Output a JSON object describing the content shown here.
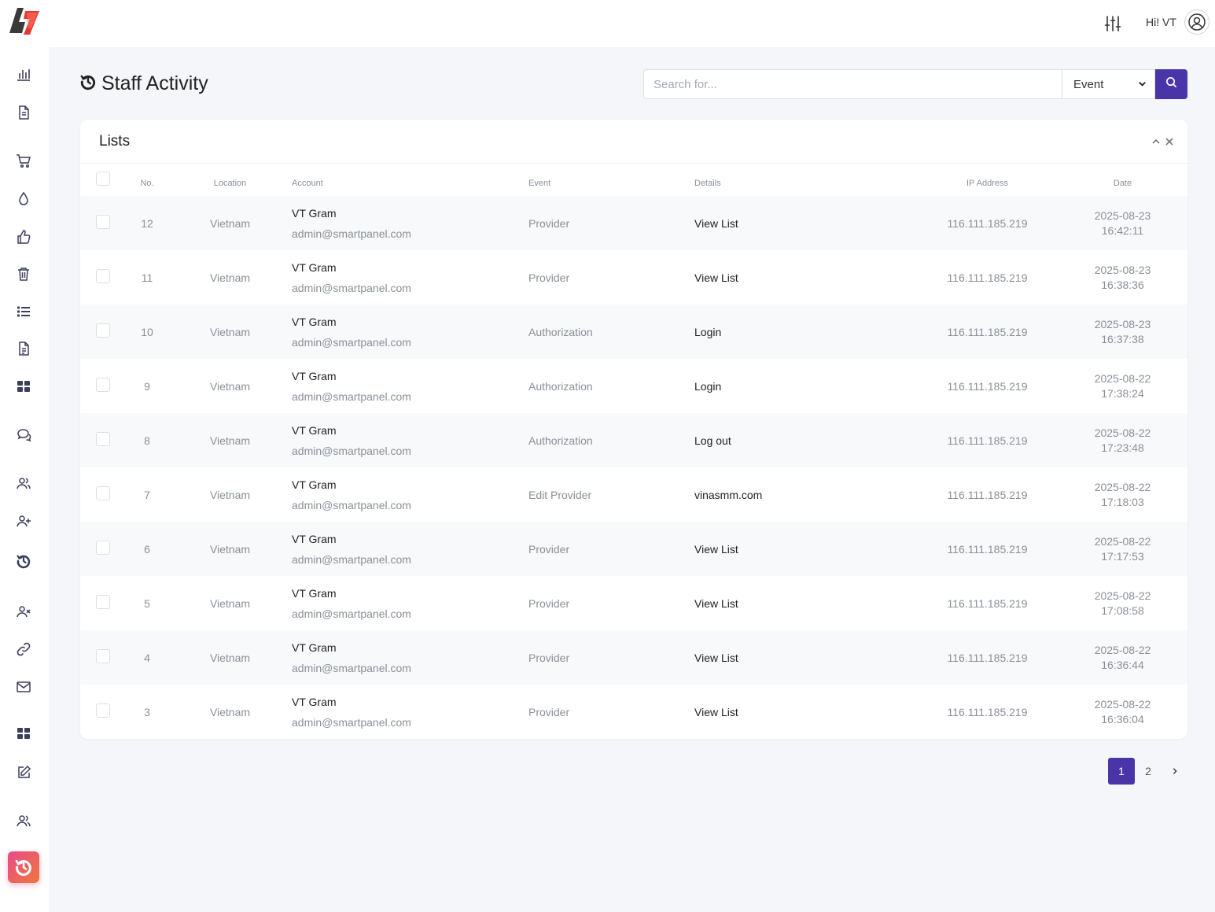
{
  "header": {
    "greeting": "Hi! VT"
  },
  "page": {
    "title": "Staff Activity"
  },
  "search": {
    "placeholder": "Search for...",
    "filter_selected": "Event"
  },
  "card": {
    "title": "Lists"
  },
  "table": {
    "columns": [
      "No.",
      "Location",
      "Account",
      "Event",
      "Details",
      "IP Address",
      "Date"
    ],
    "rows": [
      {
        "no": "12",
        "location": "Vietnam",
        "name": "VT Gram",
        "email": "admin@smartpanel.com",
        "event": "Provider",
        "details": "View List",
        "ip": "116.111.185.219",
        "date": "2025-08-23",
        "time": "16:42:11"
      },
      {
        "no": "11",
        "location": "Vietnam",
        "name": "VT Gram",
        "email": "admin@smartpanel.com",
        "event": "Provider",
        "details": "View List",
        "ip": "116.111.185.219",
        "date": "2025-08-23",
        "time": "16:38:36"
      },
      {
        "no": "10",
        "location": "Vietnam",
        "name": "VT Gram",
        "email": "admin@smartpanel.com",
        "event": "Authorization",
        "details": "Login",
        "ip": "116.111.185.219",
        "date": "2025-08-23",
        "time": "16:37:38"
      },
      {
        "no": "9",
        "location": "Vietnam",
        "name": "VT Gram",
        "email": "admin@smartpanel.com",
        "event": "Authorization",
        "details": "Login",
        "ip": "116.111.185.219",
        "date": "2025-08-22",
        "time": "17:38:24"
      },
      {
        "no": "8",
        "location": "Vietnam",
        "name": "VT Gram",
        "email": "admin@smartpanel.com",
        "event": "Authorization",
        "details": "Log out",
        "ip": "116.111.185.219",
        "date": "2025-08-22",
        "time": "17:23:48"
      },
      {
        "no": "7",
        "location": "Vietnam",
        "name": "VT Gram",
        "email": "admin@smartpanel.com",
        "event": "Edit Provider",
        "details": "vinasmm.com",
        "ip": "116.111.185.219",
        "date": "2025-08-22",
        "time": "17:18:03"
      },
      {
        "no": "6",
        "location": "Vietnam",
        "name": "VT Gram",
        "email": "admin@smartpanel.com",
        "event": "Provider",
        "details": "View List",
        "ip": "116.111.185.219",
        "date": "2025-08-22",
        "time": "17:17:53"
      },
      {
        "no": "5",
        "location": "Vietnam",
        "name": "VT Gram",
        "email": "admin@smartpanel.com",
        "event": "Provider",
        "details": "View List",
        "ip": "116.111.185.219",
        "date": "2025-08-22",
        "time": "17:08:58"
      },
      {
        "no": "4",
        "location": "Vietnam",
        "name": "VT Gram",
        "email": "admin@smartpanel.com",
        "event": "Provider",
        "details": "View List",
        "ip": "116.111.185.219",
        "date": "2025-08-22",
        "time": "16:36:44"
      },
      {
        "no": "3",
        "location": "Vietnam",
        "name": "VT Gram",
        "email": "admin@smartpanel.com",
        "event": "Provider",
        "details": "View List",
        "ip": "116.111.185.219",
        "date": "2025-08-22",
        "time": "16:36:04"
      }
    ]
  },
  "pagination": {
    "pages": [
      "1",
      "2"
    ],
    "current": "1",
    "next_icon": "chevron-right-icon"
  },
  "sidebar": {
    "icons": [
      "bar-chart-icon",
      "document-icon",
      "cart-icon",
      "droplet-icon",
      "thumbs-up-icon",
      "trash-icon",
      "list-icon",
      "file-text-icon",
      "grid-icon",
      "chat-icon",
      "users-icon",
      "user-plus-icon",
      "history-icon",
      "user-x-icon",
      "link-icon",
      "mail-icon",
      "grid-icon",
      "edit-icon",
      "users-icon",
      "history-icon"
    ],
    "active": "history-icon"
  },
  "colors": {
    "accent": "#4a35a8",
    "active_gradient_start": "#e84a8a",
    "active_gradient_end": "#f0773a",
    "background": "#f5f6fa"
  }
}
